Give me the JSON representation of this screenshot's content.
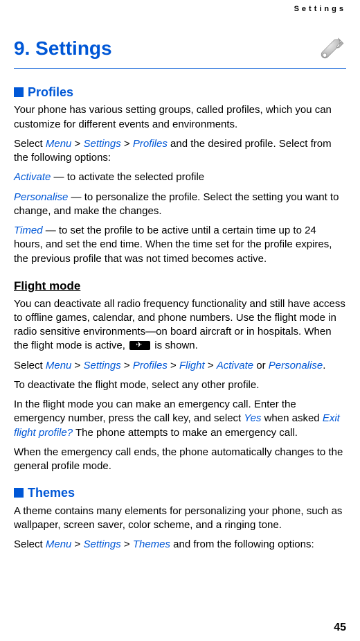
{
  "runningHeader": "Settings",
  "chapter": {
    "number": "9.",
    "title": "Settings"
  },
  "sections": {
    "profiles": {
      "heading": "Profiles",
      "intro": "Your phone has various setting groups, called profiles, which you can customize for different events and environments.",
      "navPrefix": "Select ",
      "menu": "Menu",
      "settings": "Settings",
      "profiles": "Profiles",
      "navSuffix": " and the desired profile. Select from the following options:",
      "activate": {
        "label": "Activate",
        "text": " — to activate the selected profile"
      },
      "personalise": {
        "label": "Personalise",
        "text": " — to personalize the profile. Select the setting you want to change, and make the changes."
      },
      "timed": {
        "label": "Timed",
        "text": " — to set the profile to be active until a certain time up to 24 hours, and set the end time. When the time set for the profile expires, the previous profile that was not timed becomes active."
      }
    },
    "flight": {
      "heading": "Flight mode",
      "intro1": "You can deactivate all radio frequency functionality and still have access to offline games, calendar, and phone numbers. Use the flight mode in radio sensitive environments—on board aircraft or in hospitals. When the flight mode is active, ",
      "intro2": " is shown.",
      "navPrefix": "Select ",
      "menu": "Menu",
      "settings": "Settings",
      "profiles": "Profiles",
      "flight": "Flight ",
      "activate": "Activate",
      "or": " or ",
      "personalise": "Personalise",
      "period": ".",
      "deactivate": "To deactivate the flight mode, select any other profile.",
      "emergency1": "In the flight mode you can make an emergency call. Enter the emergency number, press the call key, and select ",
      "yes": "Yes",
      "emergency2": " when asked ",
      "exitPrompt": "Exit flight profile?",
      "emergency3": " The phone attempts to make an emergency call.",
      "afterCall": "When the emergency call ends, the phone automatically changes to the general profile mode."
    },
    "themes": {
      "heading": "Themes",
      "intro": "A theme contains many elements for personalizing your phone, such as wallpaper, screen saver, color scheme, and a ringing tone.",
      "navPrefix": "Select ",
      "menu": "Menu",
      "settings": "Settings",
      "themes": "Themes",
      "navSuffix": " and from the following options:"
    }
  },
  "gt": " > ",
  "pageNumber": "45"
}
